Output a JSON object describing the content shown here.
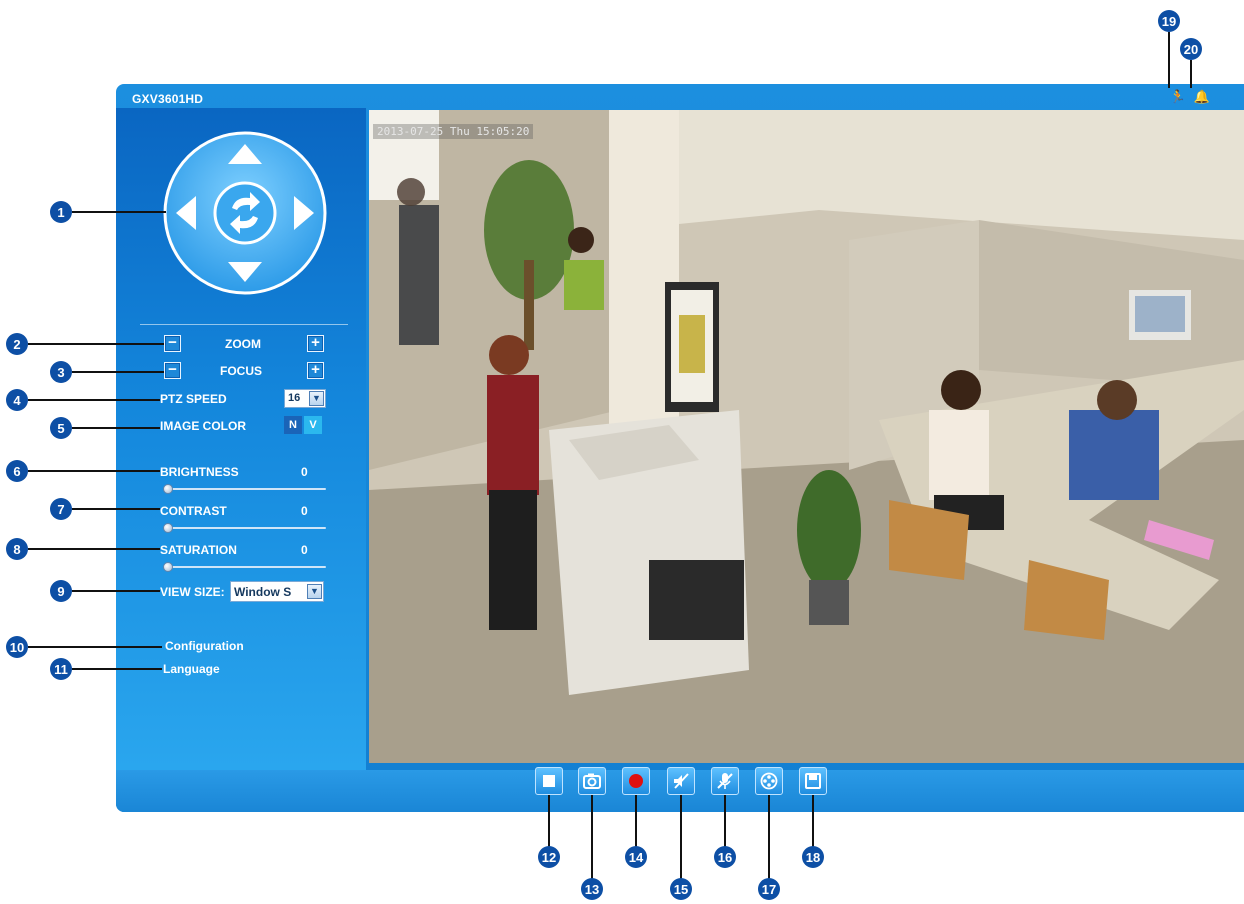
{
  "app": {
    "title": "GXV3601HD",
    "timestamp": "2013-07-25 Thu 15:05:20"
  },
  "status_icons": [
    {
      "name": "motion-detection-icon",
      "glyph": "🏃"
    },
    {
      "name": "alarm-bell-icon",
      "glyph": "🔔"
    }
  ],
  "controls": {
    "zoom_label": "ZOOM",
    "focus_label": "FOCUS",
    "minus_glyph": "−",
    "plus_glyph": "+",
    "ptz_speed_label": "PTZ SPEED",
    "ptz_speed_value": "16",
    "image_color_label": "IMAGE COLOR",
    "image_color_n": "N",
    "image_color_v": "V",
    "brightness_label": "BRIGHTNESS",
    "brightness_value": "0",
    "contrast_label": "CONTRAST",
    "contrast_value": "0",
    "saturation_label": "SATURATION",
    "saturation_value": "0",
    "view_size_label": "VIEW SIZE:",
    "view_size_value": "Window S",
    "dropdown_glyph": "▼"
  },
  "links": {
    "configuration": "Configuration",
    "language": "Language"
  },
  "toolbar": [
    {
      "name": "stop-button",
      "icon": "stop-icon"
    },
    {
      "name": "snapshot-button",
      "icon": "camera-icon"
    },
    {
      "name": "record-button",
      "icon": "record-icon"
    },
    {
      "name": "audio-mute-button",
      "icon": "speaker-mute-icon"
    },
    {
      "name": "microphone-button",
      "icon": "microphone-mute-icon"
    },
    {
      "name": "playback-button",
      "icon": "film-reel-icon"
    },
    {
      "name": "save-button",
      "icon": "floppy-disk-icon"
    }
  ],
  "callouts": [
    "1",
    "2",
    "3",
    "4",
    "5",
    "6",
    "7",
    "8",
    "9",
    "10",
    "11",
    "12",
    "13",
    "14",
    "15",
    "16",
    "17",
    "18",
    "19",
    "20"
  ],
  "colors": {
    "panel_blue": "#127fd2",
    "callout_blue": "#0d4fa5",
    "record_red": "#e01010",
    "n_button": "#1a64b8",
    "v_button": "#2bb8ee"
  }
}
